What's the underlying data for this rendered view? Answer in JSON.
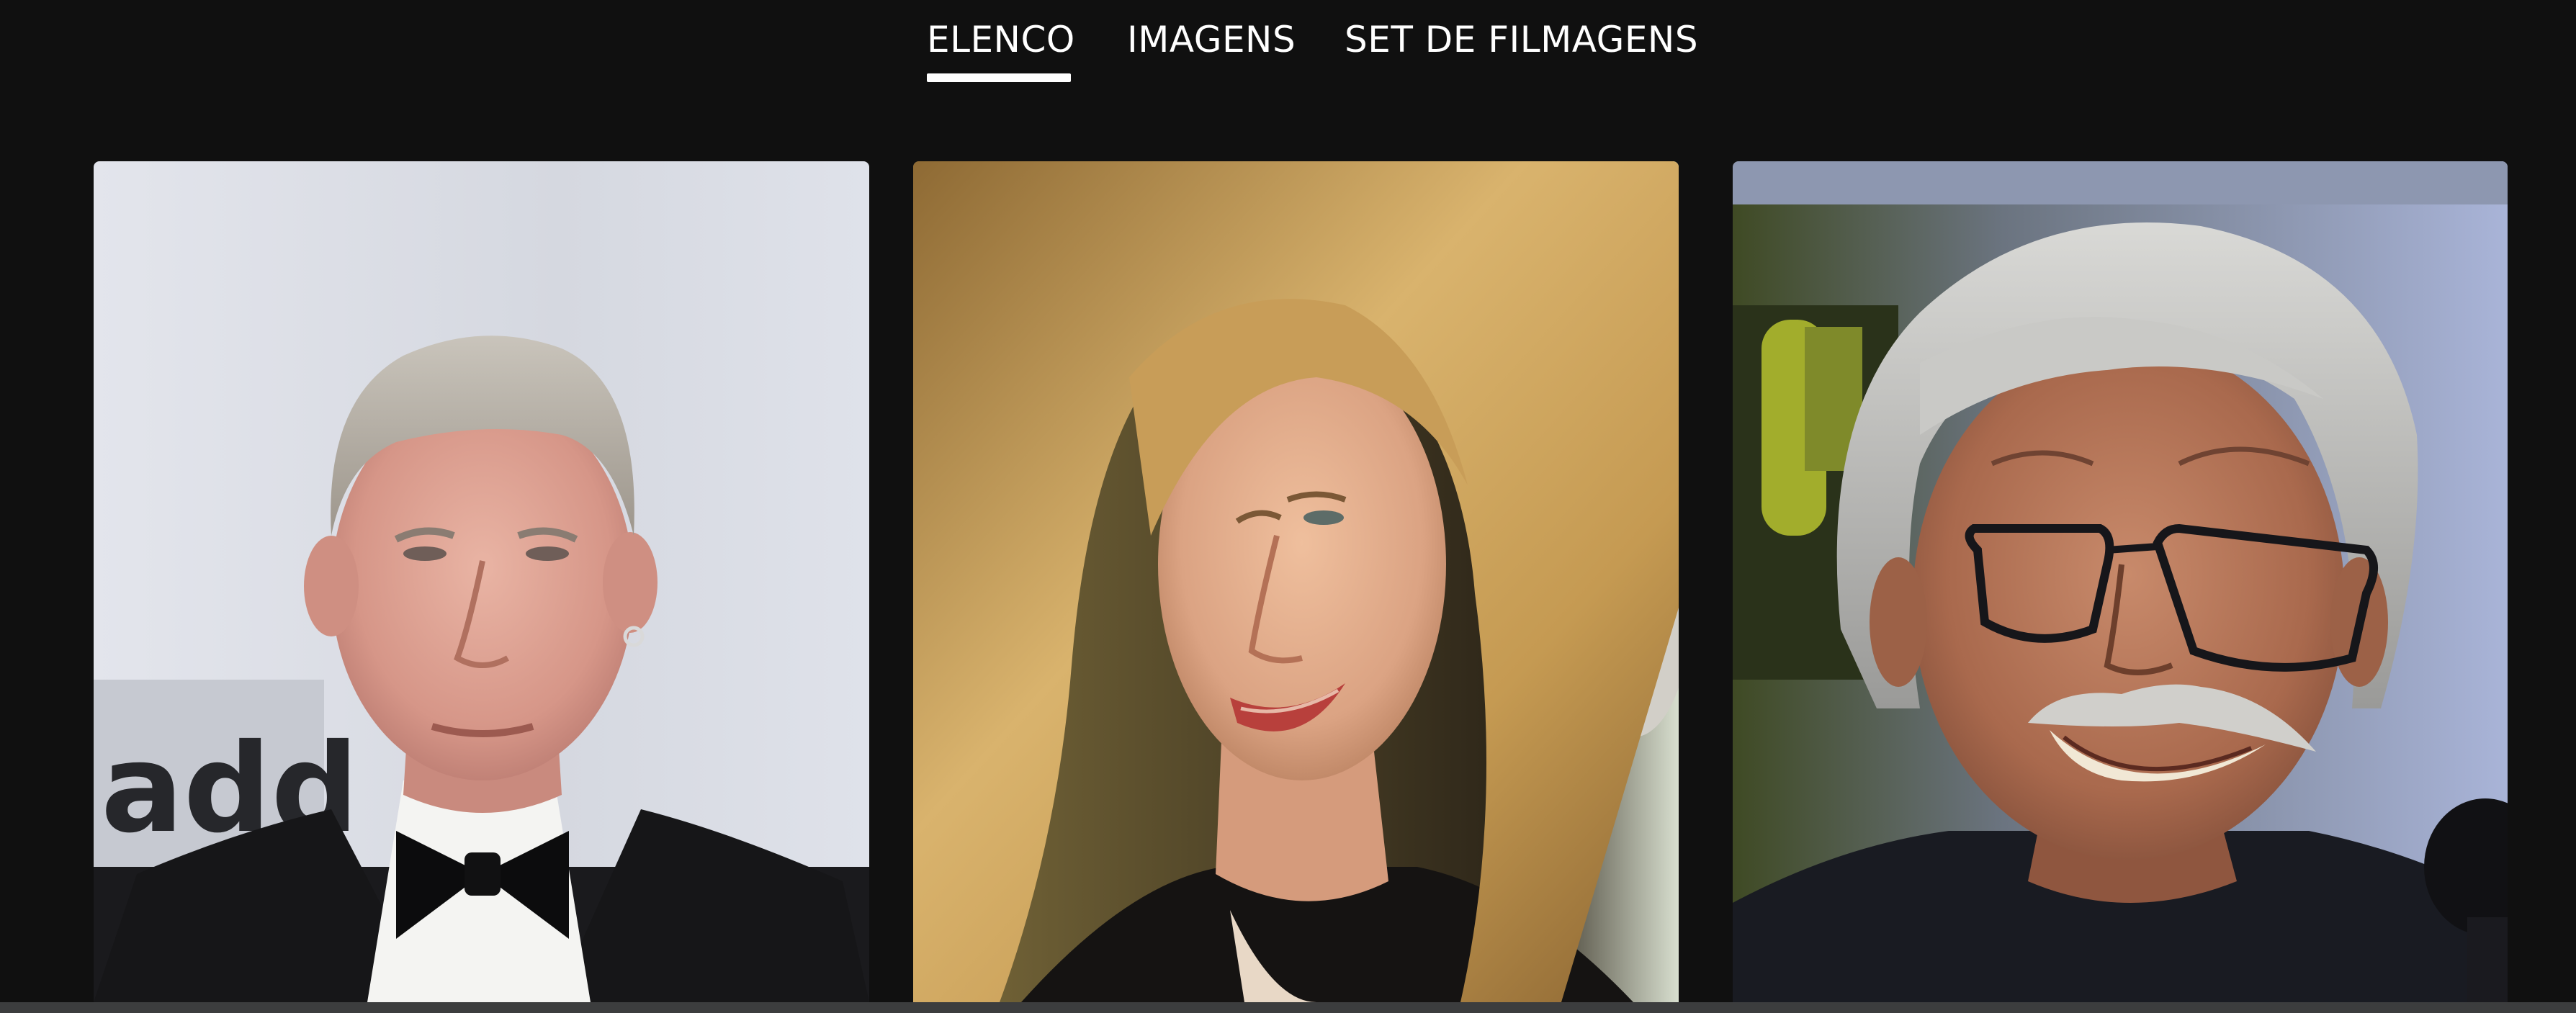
{
  "tabs": [
    {
      "label": "ELENCO",
      "active": true
    },
    {
      "label": "IMAGENS",
      "active": false
    },
    {
      "label": "SET DE FILMAGENS",
      "active": false
    }
  ],
  "cast": [
    {
      "portrait": "man-gray-hair-tuxedo-bowtie"
    },
    {
      "portrait": "woman-blonde-hair"
    },
    {
      "portrait": "man-gray-hair-glasses-mustache"
    }
  ],
  "colors": {
    "background": "#101010",
    "text": "#ffffff",
    "active_indicator": "#ffffff",
    "footer_bar": "#3c3d3e"
  }
}
